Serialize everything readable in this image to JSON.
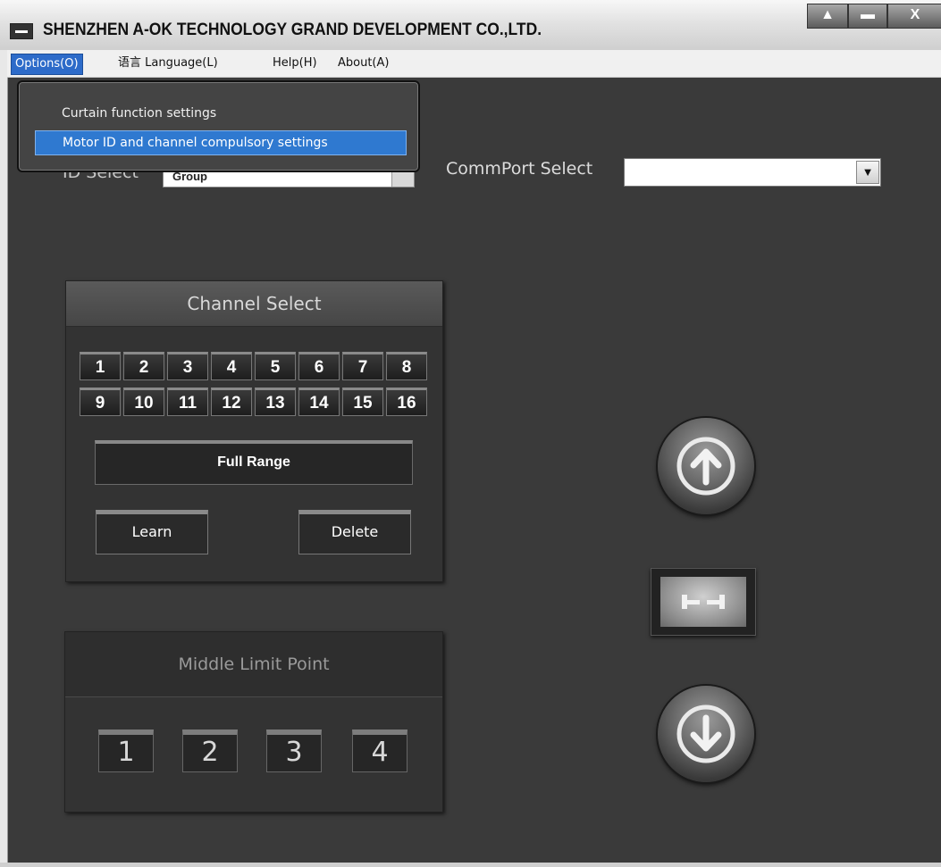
{
  "window": {
    "title": "SHENZHEN A-OK TECHNOLOGY GRAND DEVELOPMENT CO.,LTD.",
    "controls": [
      "▲",
      "▬",
      "X"
    ]
  },
  "menubar": {
    "options": "Options(O)",
    "language": "语言 Language(L)",
    "help": "Help(H)",
    "about": "About(A)"
  },
  "options_menu": {
    "items": [
      "Curtain function settings",
      "Motor ID and channel compulsory settings"
    ],
    "highlighted_index": 1
  },
  "id_select": {
    "label": "ID Select",
    "value": "Group"
  },
  "commport": {
    "label": "CommPort Select",
    "value": ""
  },
  "channel_panel": {
    "title": "Channel Select",
    "channels": [
      "1",
      "2",
      "3",
      "4",
      "5",
      "6",
      "7",
      "8",
      "9",
      "10",
      "11",
      "12",
      "13",
      "14",
      "15",
      "16"
    ],
    "full_range": "Full Range",
    "learn": "Learn",
    "delete": "Delete"
  },
  "middle_panel": {
    "title": "Middle Limit Point",
    "points": [
      "1",
      "2",
      "3",
      "4"
    ]
  },
  "controls": {
    "up_icon": "arrow-up-icon",
    "stop_icon": "stop-icon",
    "down_icon": "arrow-down-icon"
  },
  "colors": {
    "background": "#3a3a3a",
    "menu_highlight": "#2d6bc9",
    "dropdown_highlight": "#2f79d0"
  }
}
